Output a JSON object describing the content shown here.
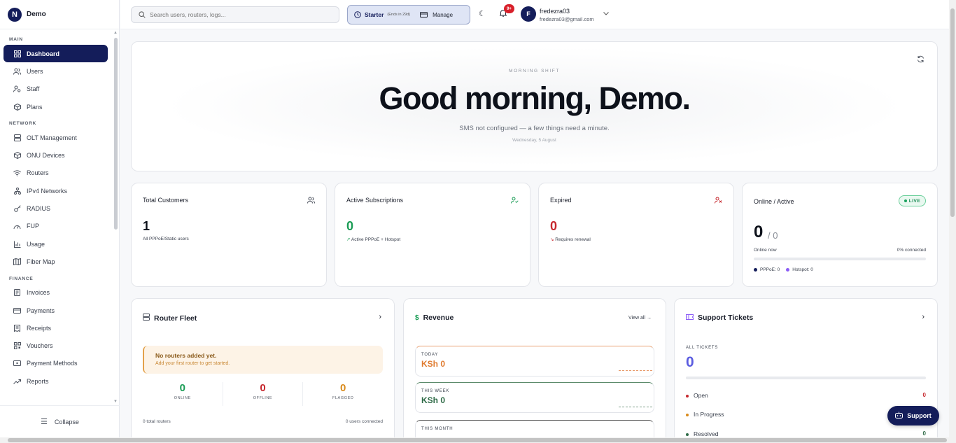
{
  "brand": {
    "initial": "N",
    "name": "Demo"
  },
  "sidebar": {
    "sections": [
      {
        "label": "MAIN",
        "items": [
          {
            "label": "Dashboard",
            "icon": "dashboard-icon",
            "active": true
          },
          {
            "label": "Users",
            "icon": "users-icon"
          },
          {
            "label": "Staff",
            "icon": "staff-icon"
          },
          {
            "label": "Plans",
            "icon": "plans-icon"
          }
        ]
      },
      {
        "label": "NETWORK",
        "items": [
          {
            "label": "OLT Management",
            "icon": "server-icon"
          },
          {
            "label": "ONU Devices",
            "icon": "box-icon"
          },
          {
            "label": "Routers",
            "icon": "wifi-icon"
          },
          {
            "label": "IPv4 Networks",
            "icon": "network-icon"
          },
          {
            "label": "RADIUS",
            "icon": "key-icon"
          },
          {
            "label": "FUP",
            "icon": "gauge-icon"
          },
          {
            "label": "Usage",
            "icon": "bar-chart-icon"
          },
          {
            "label": "Fiber Map",
            "icon": "map-icon"
          }
        ]
      },
      {
        "label": "FINANCE",
        "items": [
          {
            "label": "Invoices",
            "icon": "invoice-icon"
          },
          {
            "label": "Payments",
            "icon": "card-icon"
          },
          {
            "label": "Receipts",
            "icon": "receipt-icon"
          },
          {
            "label": "Vouchers",
            "icon": "voucher-icon"
          },
          {
            "label": "Payment Methods",
            "icon": "wallet-icon"
          },
          {
            "label": "Reports",
            "icon": "trend-icon"
          }
        ]
      }
    ],
    "collapse_label": "Collapse"
  },
  "header": {
    "search_placeholder": "Search users, routers, logs...",
    "plan_name": "Starter",
    "plan_ends": "(Ends in 29d)",
    "manage_label": "Manage",
    "notif_badge": "9+",
    "user_initial": "F",
    "user_name": "fredezra03",
    "user_email": "fredezra03@gmail.com"
  },
  "hero": {
    "shift": "MORNING SHIFT",
    "greeting": "Good morning, Demo.",
    "subtitle": "SMS not configured — a few things need a minute.",
    "date": "Wednesday, 5 August"
  },
  "stats": {
    "total_customers": {
      "title": "Total Customers",
      "value": "1",
      "note": "All PPPoE/Static users"
    },
    "active_subscriptions": {
      "title": "Active Subscriptions",
      "value": "0",
      "note": "Active PPPoE + Hotspot"
    },
    "expired": {
      "title": "Expired",
      "value": "0",
      "note": "Requires renewal"
    },
    "online": {
      "title": "Online / Active",
      "live": "LIVE",
      "value": "0",
      "total": "/ 0",
      "label": "Online now",
      "pct": "0% connected",
      "fraction": 0,
      "pppoe": "PPPoE: 0",
      "hotspot": "Hotspot: 0"
    }
  },
  "router_fleet": {
    "title": "Router Fleet",
    "alert_title": "No routers added yet.",
    "alert_sub": "Add your first router to get started.",
    "online": "0",
    "online_label": "ONLINE",
    "offline": "0",
    "offline_label": "OFFLINE",
    "flagged": "0",
    "flagged_label": "FLAGGED",
    "total": "0 total routers",
    "connected": "0 users connected"
  },
  "revenue": {
    "title": "Revenue",
    "view_all": "View all →",
    "today_label": "TODAY",
    "today_value": "KSh 0",
    "week_label": "THIS WEEK",
    "week_value": "KSh 0",
    "month_label": "THIS MONTH"
  },
  "tickets": {
    "title": "Support Tickets",
    "all_label": "ALL TICKETS",
    "all_value": "0",
    "open_label": "Open",
    "open_value": "0",
    "progress_label": "In Progress",
    "resolved_label": "Resolved",
    "resolved_value": "0"
  },
  "support_button": "Support",
  "colors": {
    "navy": "#141d5a",
    "green": "#1a9c55",
    "red": "#c6282e",
    "orange": "#e07b30",
    "violet": "#5b5de0"
  }
}
